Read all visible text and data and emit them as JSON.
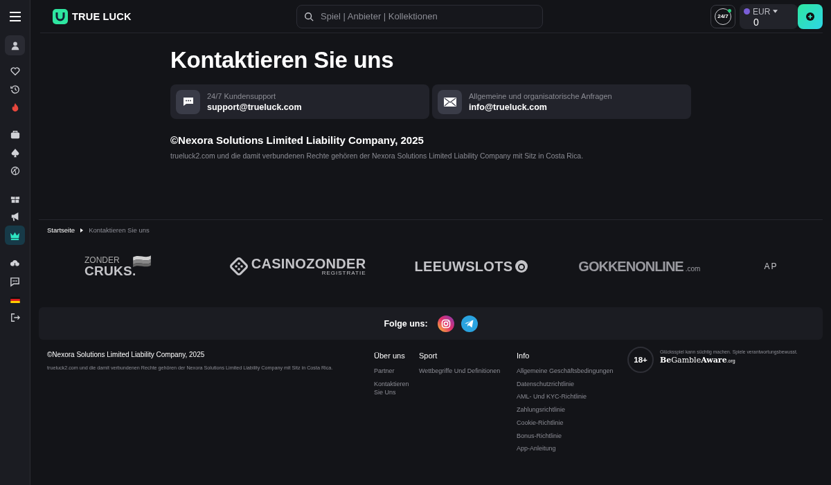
{
  "sidebar": {
    "items": [
      {
        "selected": false
      },
      {
        "selected": false
      },
      {
        "selected": false
      },
      {
        "selected": false
      },
      {
        "selected": false
      },
      {
        "selected": false
      },
      {
        "selected": false
      },
      {
        "selected": false
      },
      {
        "selected": true
      },
      {
        "selected": false
      },
      {
        "selected": false
      },
      {
        "selected": false
      },
      {
        "selected": false
      }
    ]
  },
  "header": {
    "logo": "TRUE LUCK",
    "search": {
      "placeholder": "Spiel | Anbieter | Kollektionen"
    },
    "support_badge": "24/7",
    "wallet": {
      "currency": "EUR",
      "balance": "0"
    }
  },
  "page": {
    "title": "Kontaktieren Sie uns",
    "contacts": [
      {
        "label": "24/7 Kundensupport",
        "email": "support@trueluck.com",
        "kind": "chat"
      },
      {
        "label": "Allgemeine und organisatorische Anfragen",
        "email": "info@trueluck.com",
        "kind": "mail"
      }
    ],
    "copyright": "©Nexora Solutions Limited Liability Company, 2025",
    "legal": "trueluck2.com und die damit verbundenen Rechte gehören der Nexora Solutions Limited Liability Company mit Sitz in Costa Rica."
  },
  "breadcrumb": [
    "Startseite",
    "Kontaktieren Sie uns"
  ],
  "partners": [
    {
      "kind": "flag",
      "top": "ZONDER",
      "main": "CRUKS."
    },
    {
      "kind": "dice",
      "main": "CASINOZONDER",
      "sub": "REGISTRATIE"
    },
    {
      "kind": "lion",
      "main": "LEEUWSLOTS"
    },
    {
      "kind": "plain",
      "main": "GOKKENONLINE",
      "suffix": ".com"
    },
    {
      "kind": "cut",
      "main": "AP"
    }
  ],
  "social": {
    "label": "Folge uns:"
  },
  "footer": {
    "copyright": "©Nexora Solutions Limited Liability Company, 2025",
    "legal": "trueluck2.com und die damit verbundenen Rechte gehören der Nexora Solutions Limited Liability Company mit Sitz in Costa Rica.",
    "columns": [
      {
        "title": "Über uns",
        "links": [
          "Partner",
          "Kontaktieren Sie Uns"
        ]
      },
      {
        "title": "Sport",
        "links": [
          "Wettbegriffe Und Definitionen"
        ]
      },
      {
        "title": "Info",
        "links": [
          "Allgemeine Geschäftsbedingungen",
          "Datenschutzrichtlinie",
          "AML- Und KYC-Richtlinie",
          "Zahlungsrichtlinie",
          "Cookie-Richtlinie",
          "Bonus-Richtlinie",
          "App-Anleitung"
        ]
      }
    ],
    "age": "18+",
    "warning": "Glücksspiel kann süchtig machen. Spiele verantwortungsbewusst.",
    "aware": {
      "be": "Be",
      "gamble": "Gamble",
      "aware": "Aware",
      "org": ".org"
    }
  }
}
